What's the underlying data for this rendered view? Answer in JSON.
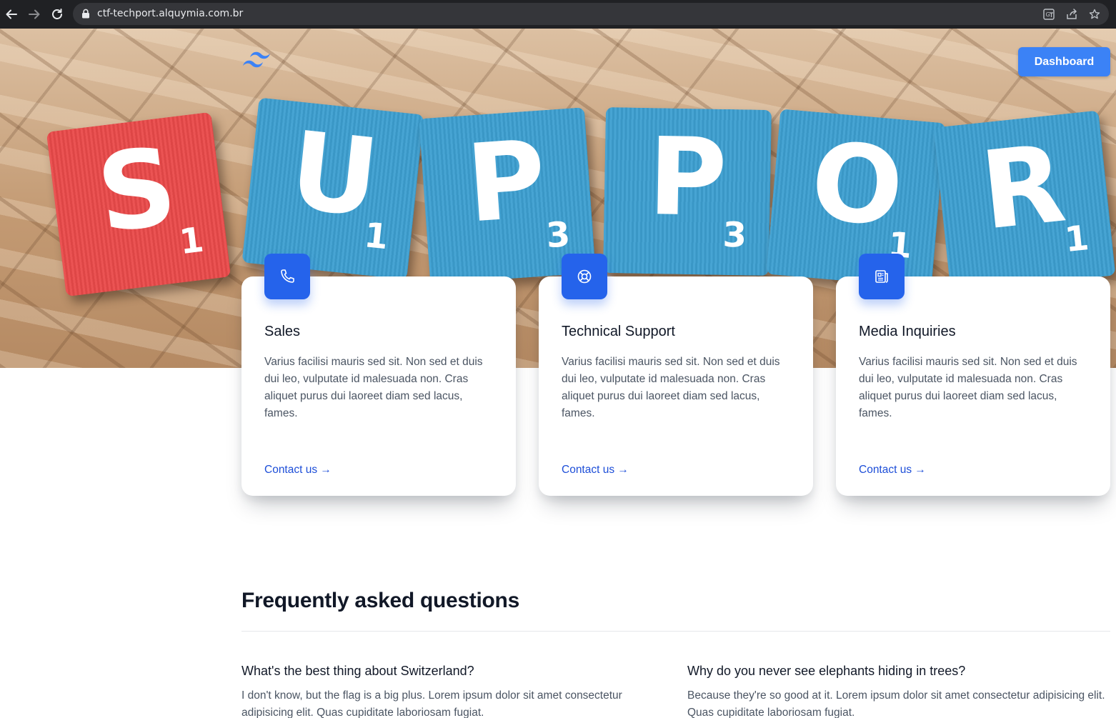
{
  "browser": {
    "url": "ctf-techport.alquymia.com.br",
    "icons": [
      "back-icon",
      "forward-icon",
      "reload-icon",
      "lock-icon",
      "translate-icon",
      "share-icon",
      "bookmark-star-icon"
    ]
  },
  "hero": {
    "tiles": [
      {
        "letter": "S",
        "sub": "1",
        "color": "#ea4a4a"
      },
      {
        "letter": "U",
        "sub": "1",
        "color": "#3d9fd1"
      },
      {
        "letter": "P",
        "sub": "3",
        "color": "#3d9fd1"
      },
      {
        "letter": "P",
        "sub": "3",
        "color": "#3d9fd1"
      },
      {
        "letter": "O",
        "sub": "1",
        "color": "#3d9fd1"
      },
      {
        "letter": "R",
        "sub": "1",
        "color": "#3d9fd1"
      }
    ],
    "logo_icon": "tailwind-logo-icon",
    "dashboard_label": "Dashboard"
  },
  "cards": [
    {
      "icon": "phone-icon",
      "title": "Sales",
      "body": "Varius facilisi mauris sed sit. Non sed et duis dui leo, vulputate id malesuada non. Cras aliquet purus dui laoreet diam sed lacus, fames.",
      "link": "Contact us →"
    },
    {
      "icon": "lifebuoy-icon",
      "title": "Technical Support",
      "body": "Varius facilisi mauris sed sit. Non sed et duis dui leo, vulputate id malesuada non. Cras aliquet purus dui laoreet diam sed lacus, fames.",
      "link": "Contact us →"
    },
    {
      "icon": "newspaper-icon",
      "title": "Media Inquiries",
      "body": "Varius facilisi mauris sed sit. Non sed et duis dui leo, vulputate id malesuada non. Cras aliquet purus dui laoreet diam sed lacus, fames.",
      "link": "Contact us →"
    }
  ],
  "faq": {
    "title": "Frequently asked questions",
    "items": [
      {
        "question": "What's the best thing about Switzerland?",
        "answer": "I don't know, but the flag is a big plus. Lorem ipsum dolor sit amet consectetur adipisicing elit. Quas cupiditate laboriosam fugiat."
      },
      {
        "question": "Why do you never see elephants hiding in trees?",
        "answer": "Because they're so good at it. Lorem ipsum dolor sit amet consectetur adipisicing elit. Quas cupiditate laboriosam fugiat."
      }
    ]
  },
  "colors": {
    "accent": "#2563eb",
    "button": "#3b82f6",
    "link": "#1d4ed8",
    "browser_bar": "#202124"
  }
}
